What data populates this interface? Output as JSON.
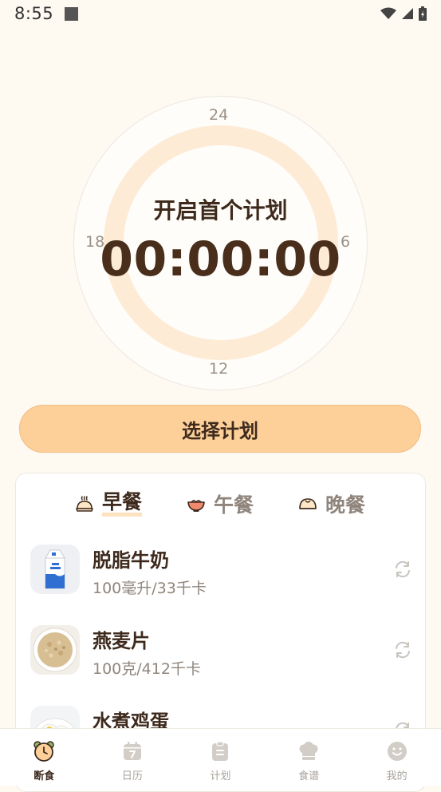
{
  "status_bar": {
    "time": "8:55"
  },
  "dial": {
    "title": "开启首个计划",
    "timer": "00:00:00",
    "ticks": {
      "top": "24",
      "right": "6",
      "bottom": "12",
      "left": "18"
    }
  },
  "select_plan_label": "选择计划",
  "meal_tabs": [
    {
      "label": "早餐",
      "icon": "steamed-bun-icon",
      "active": true
    },
    {
      "label": "午餐",
      "icon": "noodle-bowl-icon",
      "active": false
    },
    {
      "label": "晚餐",
      "icon": "dumpling-icon",
      "active": false
    }
  ],
  "foods": [
    {
      "name": "脱脂牛奶",
      "amount": "100毫升/33千卡",
      "icon": "milk-carton-icon"
    },
    {
      "name": "燕麦片",
      "amount": "100克/412千卡",
      "icon": "oatmeal-bowl-icon"
    },
    {
      "name": "水煮鸡蛋",
      "amount": "",
      "icon": "boiled-egg-icon"
    }
  ],
  "bottom_nav": [
    {
      "label": "断食",
      "icon": "alarm-clock-icon",
      "active": true
    },
    {
      "label": "日历",
      "icon": "calendar-icon",
      "active": false
    },
    {
      "label": "计划",
      "icon": "clipboard-icon",
      "active": false
    },
    {
      "label": "食谱",
      "icon": "chef-hat-icon",
      "active": false
    },
    {
      "label": "我的",
      "icon": "smiley-icon",
      "active": false
    }
  ],
  "colors": {
    "background": "#fef9f1",
    "accent": "#fdd09a",
    "ring": "#fdebd6",
    "text_dark": "#3e2a1d",
    "text_muted": "#8f857c"
  }
}
